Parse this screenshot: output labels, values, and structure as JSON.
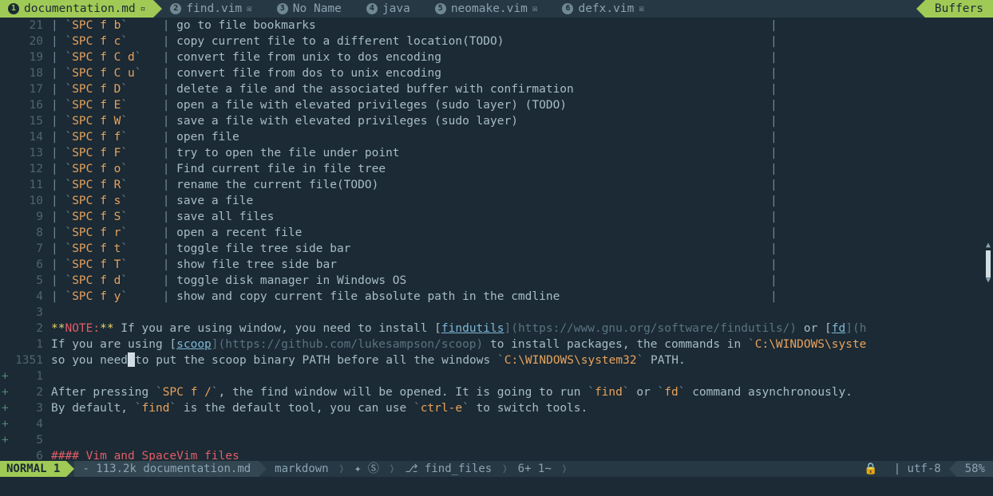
{
  "tabs": [
    {
      "num": "1",
      "label": "documentation.md",
      "mod": "▫",
      "active": true
    },
    {
      "num": "2",
      "label": "find.vim",
      "mod": "☒",
      "active": false
    },
    {
      "num": "3",
      "label": "No Name",
      "mod": "",
      "active": false
    },
    {
      "num": "4",
      "label": "java",
      "mod": "",
      "active": false
    },
    {
      "num": "5",
      "label": "neomake.vim",
      "mod": "☒",
      "active": false
    },
    {
      "num": "6",
      "label": "defx.vim",
      "mod": "☒",
      "active": false
    }
  ],
  "buffers_label": "Buffers",
  "rows": [
    {
      "g": "21",
      "key": "SPC f b",
      "desc": "go to file bookmarks"
    },
    {
      "g": "20",
      "key": "SPC f c",
      "desc": "copy current file to a different location(TODO)"
    },
    {
      "g": "19",
      "key": "SPC f C d",
      "desc": "convert file from unix to dos encoding"
    },
    {
      "g": "18",
      "key": "SPC f C u",
      "desc": "convert file from dos to unix encoding"
    },
    {
      "g": "17",
      "key": "SPC f D",
      "desc": "delete a file and the associated buffer with confirmation"
    },
    {
      "g": "16",
      "key": "SPC f E",
      "desc": "open a file with elevated privileges (sudo layer) (TODO)"
    },
    {
      "g": "15",
      "key": "SPC f W",
      "desc": "save a file with elevated privileges (sudo layer)"
    },
    {
      "g": "14",
      "key": "SPC f f",
      "desc": "open file"
    },
    {
      "g": "13",
      "key": "SPC f F",
      "desc": "try to open the file under point"
    },
    {
      "g": "12",
      "key": "SPC f o",
      "desc": "Find current file in file tree"
    },
    {
      "g": "11",
      "key": "SPC f R",
      "desc": "rename the current file(TODO)"
    },
    {
      "g": "10",
      "key": "SPC f s",
      "desc": "save a file"
    },
    {
      "g": "9",
      "key": "SPC f S",
      "desc": "save all files"
    },
    {
      "g": "8",
      "key": "SPC f r",
      "desc": "open a recent file"
    },
    {
      "g": "7",
      "key": "SPC f t",
      "desc": "toggle file tree side bar"
    },
    {
      "g": "6",
      "key": "SPC f T",
      "desc": "show file tree side bar"
    },
    {
      "g": "5",
      "key": "SPC f d",
      "desc": "toggle disk manager in Windows OS"
    },
    {
      "g": "4",
      "key": "SPC f y",
      "desc": "show and copy current file absolute path in the cmdline"
    }
  ],
  "blank1": "3",
  "note": {
    "g": "2",
    "prefix": "**",
    "label": "NOTE:",
    "suffix": "**",
    "t1": " If you are using window, you need to install [",
    "link1": "findutils",
    "u1": "](",
    "url1": "https://www.gnu.org/software/findutils/",
    "u1c": ")",
    "t2": " or [",
    "link2": "fd",
    "u2": "](",
    "tail": "h"
  },
  "scoop": {
    "g": "1",
    "t1": "If you are using [",
    "link": "scoop",
    "u": "](",
    "url": "https://github.com/lukesampson/scoop",
    "uc": ")",
    "t2": " to install packages, the commands in ",
    "code": "`C:\\WINDOWS\\syste"
  },
  "cursor": {
    "g": "1351",
    "pre": "so you need",
    "post": "to put the scoop binary PATH before all the windows ",
    "code": "`C:\\WINDOWS\\system32`",
    "tail": " PATH."
  },
  "after": [
    {
      "g": "1",
      "plus": true,
      "text": ""
    },
    {
      "g": "2",
      "plus": true,
      "spans": [
        {
          "c": "desc",
          "t": "After pressing "
        },
        {
          "c": "codetick",
          "t": "`"
        },
        {
          "c": "key",
          "t": "SPC f /"
        },
        {
          "c": "codetick",
          "t": "`"
        },
        {
          "c": "desc",
          "t": ", the find window will be opened. It is going to run "
        },
        {
          "c": "codetick",
          "t": "`"
        },
        {
          "c": "key",
          "t": "find"
        },
        {
          "c": "codetick",
          "t": "`"
        },
        {
          "c": "desc",
          "t": " or "
        },
        {
          "c": "codetick",
          "t": "`"
        },
        {
          "c": "key",
          "t": "fd"
        },
        {
          "c": "codetick",
          "t": "`"
        },
        {
          "c": "desc",
          "t": " command asynchronously."
        }
      ]
    },
    {
      "g": "3",
      "plus": true,
      "spans": [
        {
          "c": "desc",
          "t": "By default, "
        },
        {
          "c": "codetick",
          "t": "`"
        },
        {
          "c": "key",
          "t": "find"
        },
        {
          "c": "codetick",
          "t": "`"
        },
        {
          "c": "desc",
          "t": " is the default tool, you can use "
        },
        {
          "c": "codetick",
          "t": "`"
        },
        {
          "c": "key",
          "t": "ctrl-e"
        },
        {
          "c": "codetick",
          "t": "`"
        },
        {
          "c": "desc",
          "t": " to switch tools."
        }
      ]
    },
    {
      "g": "4",
      "plus": true,
      "text": ""
    },
    {
      "g": "5",
      "plus": true,
      "text": ""
    },
    {
      "g": "6",
      "plus": false,
      "heading": "#### Vim and SpaceVim files"
    }
  ],
  "status": {
    "mode": "NORMAL 1",
    "size": "- 113.2k",
    "file": "documentation.md",
    "ft": "markdown",
    "icons": "✦ Ⓢ",
    "branch": "⎇ find_files",
    "hunks": "6+ 1~",
    "lock": "🔒",
    "enc": "| utf-8",
    "pct": "58%"
  },
  "pad7": "       ",
  "pad5": "     ",
  "pad3": "   ",
  "endpad": "                                                                              "
}
